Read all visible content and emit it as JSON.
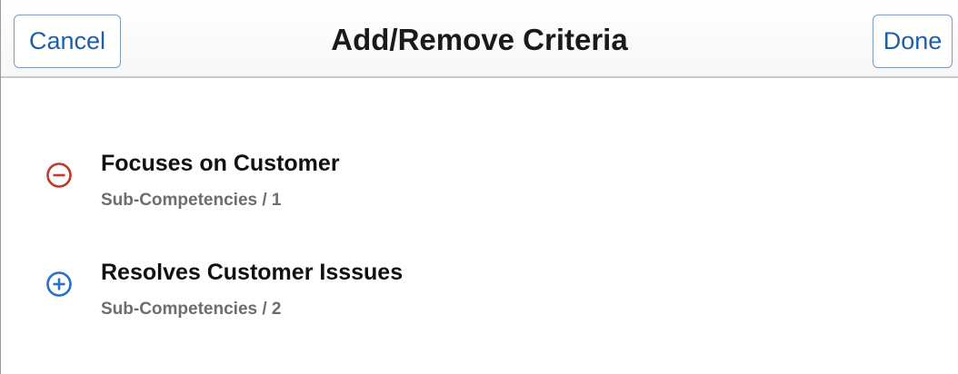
{
  "header": {
    "title": "Add/Remove Criteria",
    "cancel_label": "Cancel",
    "done_label": "Done"
  },
  "criteria": [
    {
      "name": "Focuses on Customer",
      "sub_label": "Sub-Competencies / 1",
      "action": "remove",
      "icon": "minus-circle-icon",
      "icon_color": "#c0392b"
    },
    {
      "name": "Resolves Customer Isssues",
      "sub_label": "Sub-Competencies / 2",
      "action": "add",
      "icon": "plus-circle-icon",
      "icon_color": "#2a6fc9"
    }
  ]
}
